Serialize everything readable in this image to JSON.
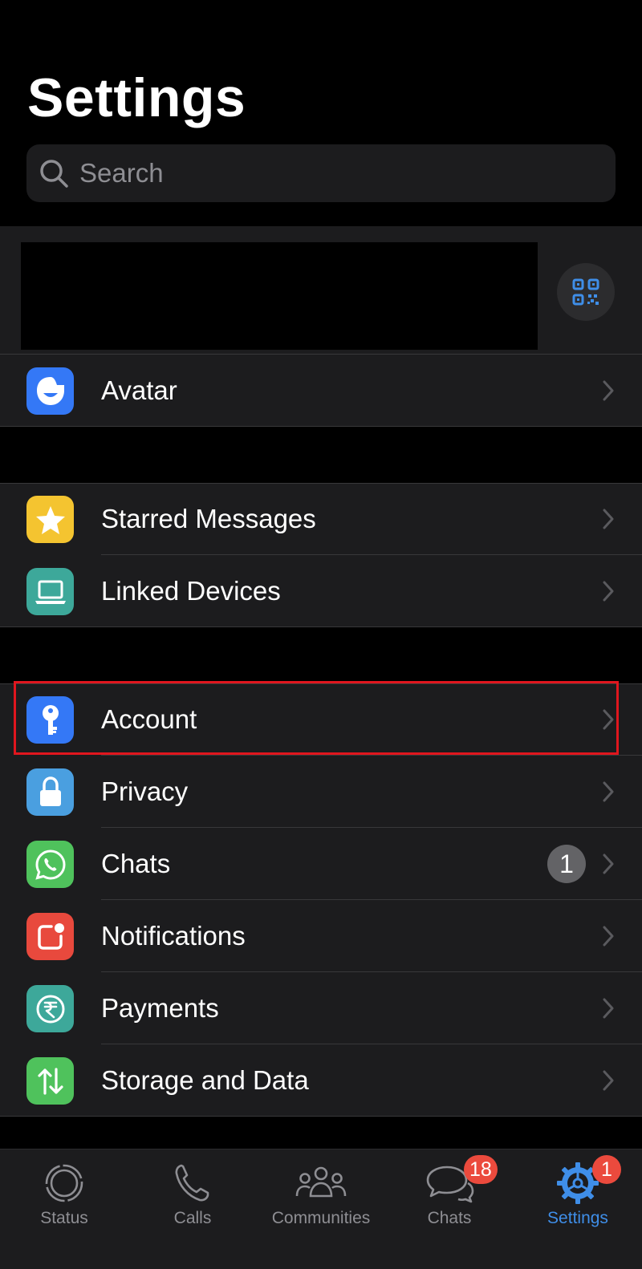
{
  "header": {
    "title": "Settings"
  },
  "search": {
    "placeholder": "Search"
  },
  "groups": {
    "avatar": {
      "label": "Avatar"
    },
    "tools": [
      {
        "label": "Starred Messages",
        "icon": "star-icon",
        "color": "#f4c430"
      },
      {
        "label": "Linked Devices",
        "icon": "laptop-icon",
        "color": "#3da89a"
      }
    ],
    "settings": [
      {
        "label": "Account",
        "icon": "key-icon",
        "color": "#3478f6"
      },
      {
        "label": "Privacy",
        "icon": "lock-icon",
        "color": "#4a9fe0"
      },
      {
        "label": "Chats",
        "icon": "whatsapp-icon",
        "color": "#4fc25c",
        "count": "1"
      },
      {
        "label": "Notifications",
        "icon": "notification-icon",
        "color": "#e8493d"
      },
      {
        "label": "Payments",
        "icon": "rupee-icon",
        "color": "#3da89a"
      },
      {
        "label": "Storage and Data",
        "icon": "arrows-updown-icon",
        "color": "#4fc25c"
      }
    ]
  },
  "tabbar": {
    "tabs": [
      {
        "label": "Status",
        "icon": "status-icon"
      },
      {
        "label": "Calls",
        "icon": "phone-icon"
      },
      {
        "label": "Communities",
        "icon": "communities-icon"
      },
      {
        "label": "Chats",
        "icon": "chat-bubbles-icon",
        "badge": "18"
      },
      {
        "label": "Settings",
        "icon": "gear-icon",
        "badge": "1",
        "active": true
      }
    ]
  },
  "colors": {
    "accent": "#3f8ee8",
    "highlight_box": "#e0161e",
    "badge": "#eb4a3d"
  }
}
